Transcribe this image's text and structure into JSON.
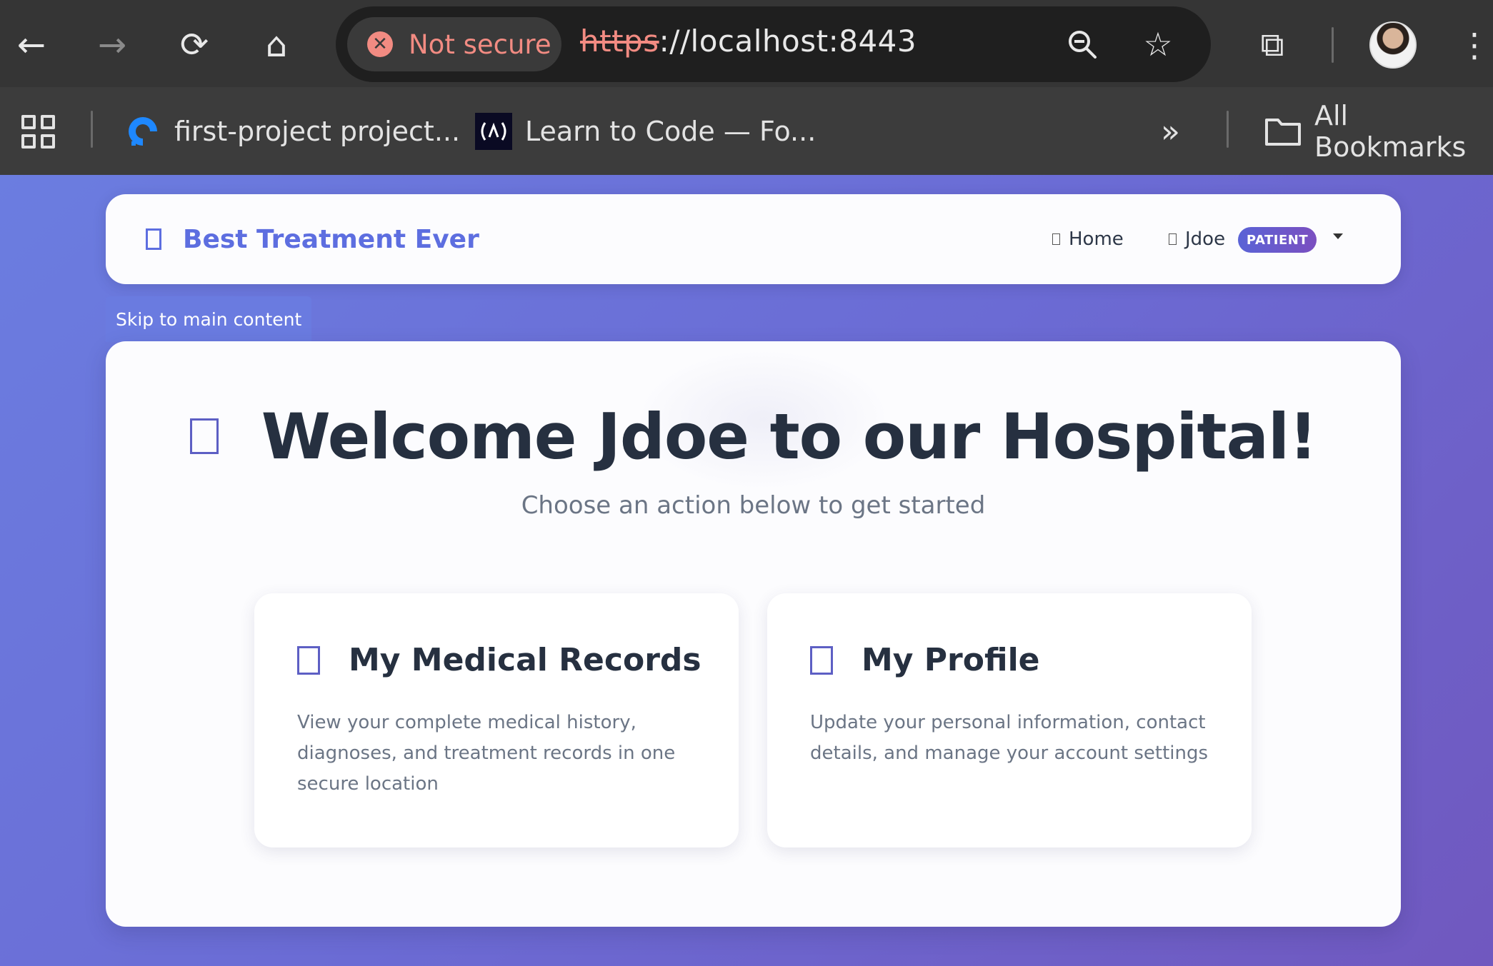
{
  "browser": {
    "nav": {
      "back_icon": "←",
      "forward_icon": "→",
      "reload_icon": "⟳",
      "home_icon": "⌂"
    },
    "omnibox": {
      "security_icon": "✕",
      "security_label": "Not secure",
      "url_scheme": "https",
      "url_rest": "://localhost:8443",
      "zoom_icon": "🔍",
      "star_icon": "☆"
    },
    "toolbar": {
      "extensions_icon": "⧉",
      "menu_icon": "⋮"
    },
    "bookmarks": {
      "items": [
        {
          "label": "first-project project..."
        },
        {
          "label": "Learn to Code — Fo..."
        }
      ],
      "overflow_icon": "»",
      "all_bookmarks_label": "All Bookmarks"
    }
  },
  "app": {
    "brand": "Best Treatment Ever",
    "nav": {
      "home_label": "Home",
      "user_label": "Jdoe",
      "role_badge": "PATIENT"
    },
    "skip_link": "Skip to main content",
    "hero": {
      "title": "Welcome Jdoe to our Hospital!",
      "subtitle": "Choose an action below to get started"
    },
    "cards": [
      {
        "title": "My Medical Records",
        "description": "View your complete medical history, diagnoses, and treatment records in one secure location"
      },
      {
        "title": "My Profile",
        "description": "Update your personal information, contact details, and manage your account settings"
      }
    ]
  },
  "colors": {
    "brand": "#5d6ee0",
    "badge_from": "#5a63d6",
    "badge_to": "#7b4fc0",
    "insecure": "#f28b82",
    "heading": "#263040"
  }
}
